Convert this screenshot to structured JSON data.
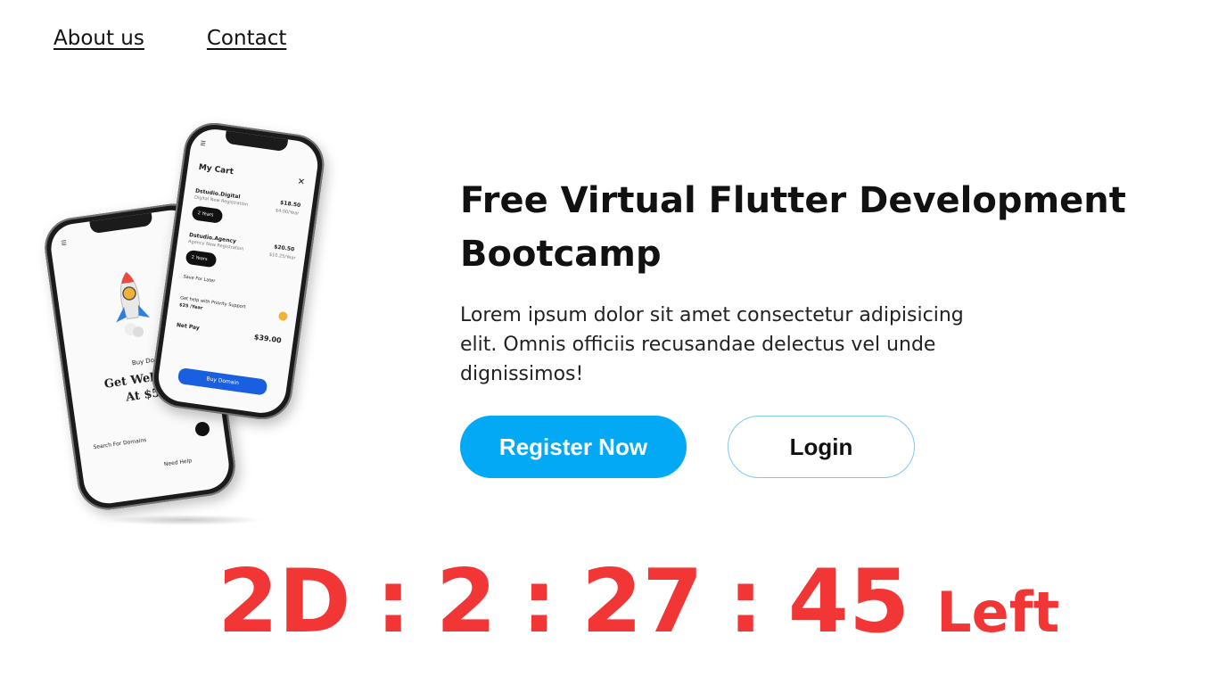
{
  "nav": {
    "about": "About us",
    "contact": "Contact"
  },
  "phone_back": {
    "subtitle": "Buy Domain",
    "heading_line1": "Get Web",
    "heading_line2": "At $5/",
    "search_placeholder": "Search For Domains",
    "help": "Need Help"
  },
  "phone_front": {
    "title": "My Cart",
    "item1_name": "Dstudio.Digital",
    "item1_sub": "Digital New Registration",
    "item1_price": "$18.50",
    "item1_term": "$4.00/Year",
    "item1_select": "2 Years",
    "item2_name": "Dstudio.Agency",
    "item2_sub": "Agency New Registration",
    "item2_price": "$20.50",
    "item2_term": "$10.25/Year",
    "item2_select": "2 Years",
    "save_later": "Save For Later",
    "support": "Get help with Priority Support",
    "support_price": "$25 /Year",
    "net_pay_label": "Net Pay",
    "net_pay_value": "$39.00",
    "buy_button": "Buy Domain"
  },
  "hero": {
    "title": "Free Virtual Flutter Development Bootcamp",
    "description": "Lorem ipsum dolor sit amet consectetur adipisicing elit. Omnis officiis recusandae delectus vel unde dignissimos!",
    "register_label": "Register Now",
    "login_label": "Login"
  },
  "countdown": {
    "days": "2D",
    "hours": "2",
    "minutes": "27",
    "seconds": "45",
    "separator": ":",
    "suffix": "Left"
  },
  "colors": {
    "accent": "#03a9f4",
    "countdown": "#f23535"
  }
}
